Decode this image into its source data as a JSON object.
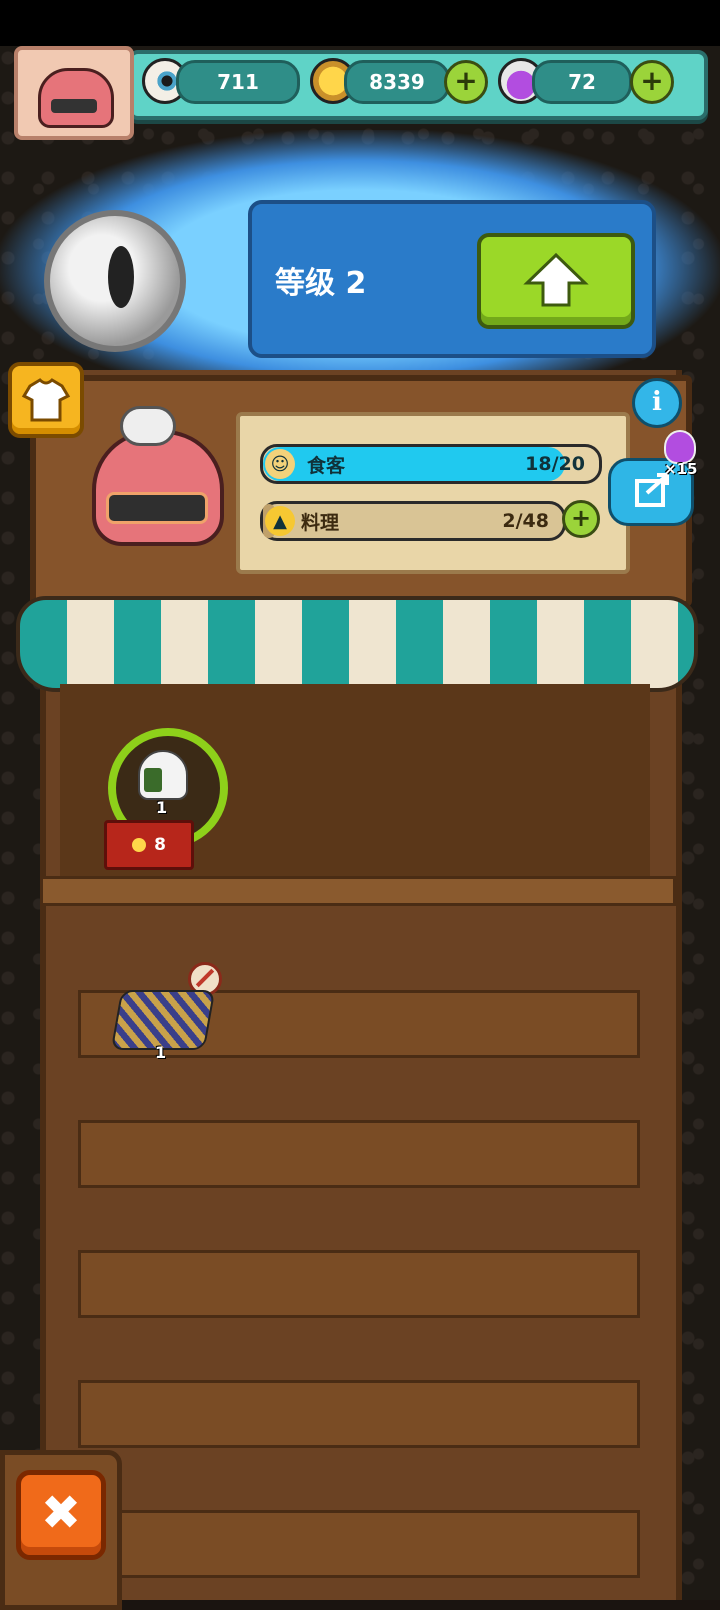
{
  "hud": {
    "eyeball_count": "711",
    "coin_count": "8339",
    "potion_count": "72",
    "plus_symbol": "+"
  },
  "level": {
    "label": "等级 2"
  },
  "shop": {
    "customers_label": "食客",
    "customers_value": "18/20",
    "customers_fill": 0.9,
    "dishes_label": "料理",
    "dishes_value": "2/48",
    "dishes_fill": 0.04,
    "potion_multiplier": "×15"
  },
  "shelf": {
    "item1_count": "1",
    "item1_price": "8",
    "item2_count": "1"
  },
  "icons": {
    "eyeball": "eyeball-icon",
    "coin": "coin-icon",
    "potion": "potion-icon",
    "upgrade": "arrow-up-icon",
    "shirt": "shirt-icon",
    "info": "info-icon",
    "share": "share-icon",
    "close": "close-icon",
    "customer": "person-icon",
    "dish": "cloche-icon"
  },
  "colors": {
    "hud_teal": "#5fd3c7",
    "upgrade_green": "#9bd828",
    "customer_bar": "#20c9ef",
    "close_orange": "#f06a1a"
  }
}
